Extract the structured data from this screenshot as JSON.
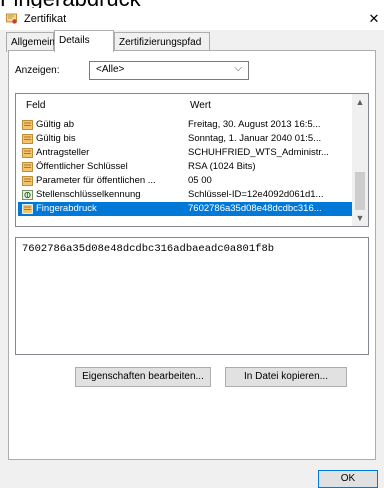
{
  "page_heading": "Fingerabdruck",
  "window": {
    "title": "Zertifikat",
    "close_symbol": "✕"
  },
  "tabs": [
    {
      "label": "Allgemein"
    },
    {
      "label": "Details"
    },
    {
      "label": "Zertifizierungspfad"
    }
  ],
  "filter": {
    "label": "Anzeigen:",
    "value": "<Alle>"
  },
  "table": {
    "columns": [
      "Feld",
      "Wert"
    ],
    "rows": [
      {
        "field": "Gültig ab",
        "value": "Freitag, 30. August 2013 16:5...",
        "icon": "certificate-field-icon"
      },
      {
        "field": "Gültig bis",
        "value": "Sonntag, 1. Januar 2040 01:5...",
        "icon": "certificate-field-icon"
      },
      {
        "field": "Antragsteller",
        "value": "SCHUHFRIED_WTS_Administr...",
        "icon": "certificate-field-icon"
      },
      {
        "field": "Öffentlicher Schlüssel",
        "value": "RSA (1024 Bits)",
        "icon": "certificate-field-icon"
      },
      {
        "field": "Parameter für öffentlichen ...",
        "value": "05 00",
        "icon": "certificate-field-icon"
      },
      {
        "field": "Stellenschlüsselkennung",
        "value": "Schlüssel-ID=12e4092d061d1...",
        "icon": "extension-icon"
      },
      {
        "field": "Fingerabdruck",
        "value": "7602786a35d08e48dcdbc316...",
        "icon": "certificate-field-icon",
        "selected": true
      }
    ]
  },
  "detail": {
    "text": "7602786a35d08e48dcdbc316adbaeadc0a801f8b"
  },
  "buttons": {
    "edit_properties": "Eigenschaften bearbeiten...",
    "copy_to_file": "In Datei kopieren...",
    "ok": "OK"
  },
  "colors": {
    "selection": "#0078d7",
    "cert_icon": "#e8a33d"
  }
}
